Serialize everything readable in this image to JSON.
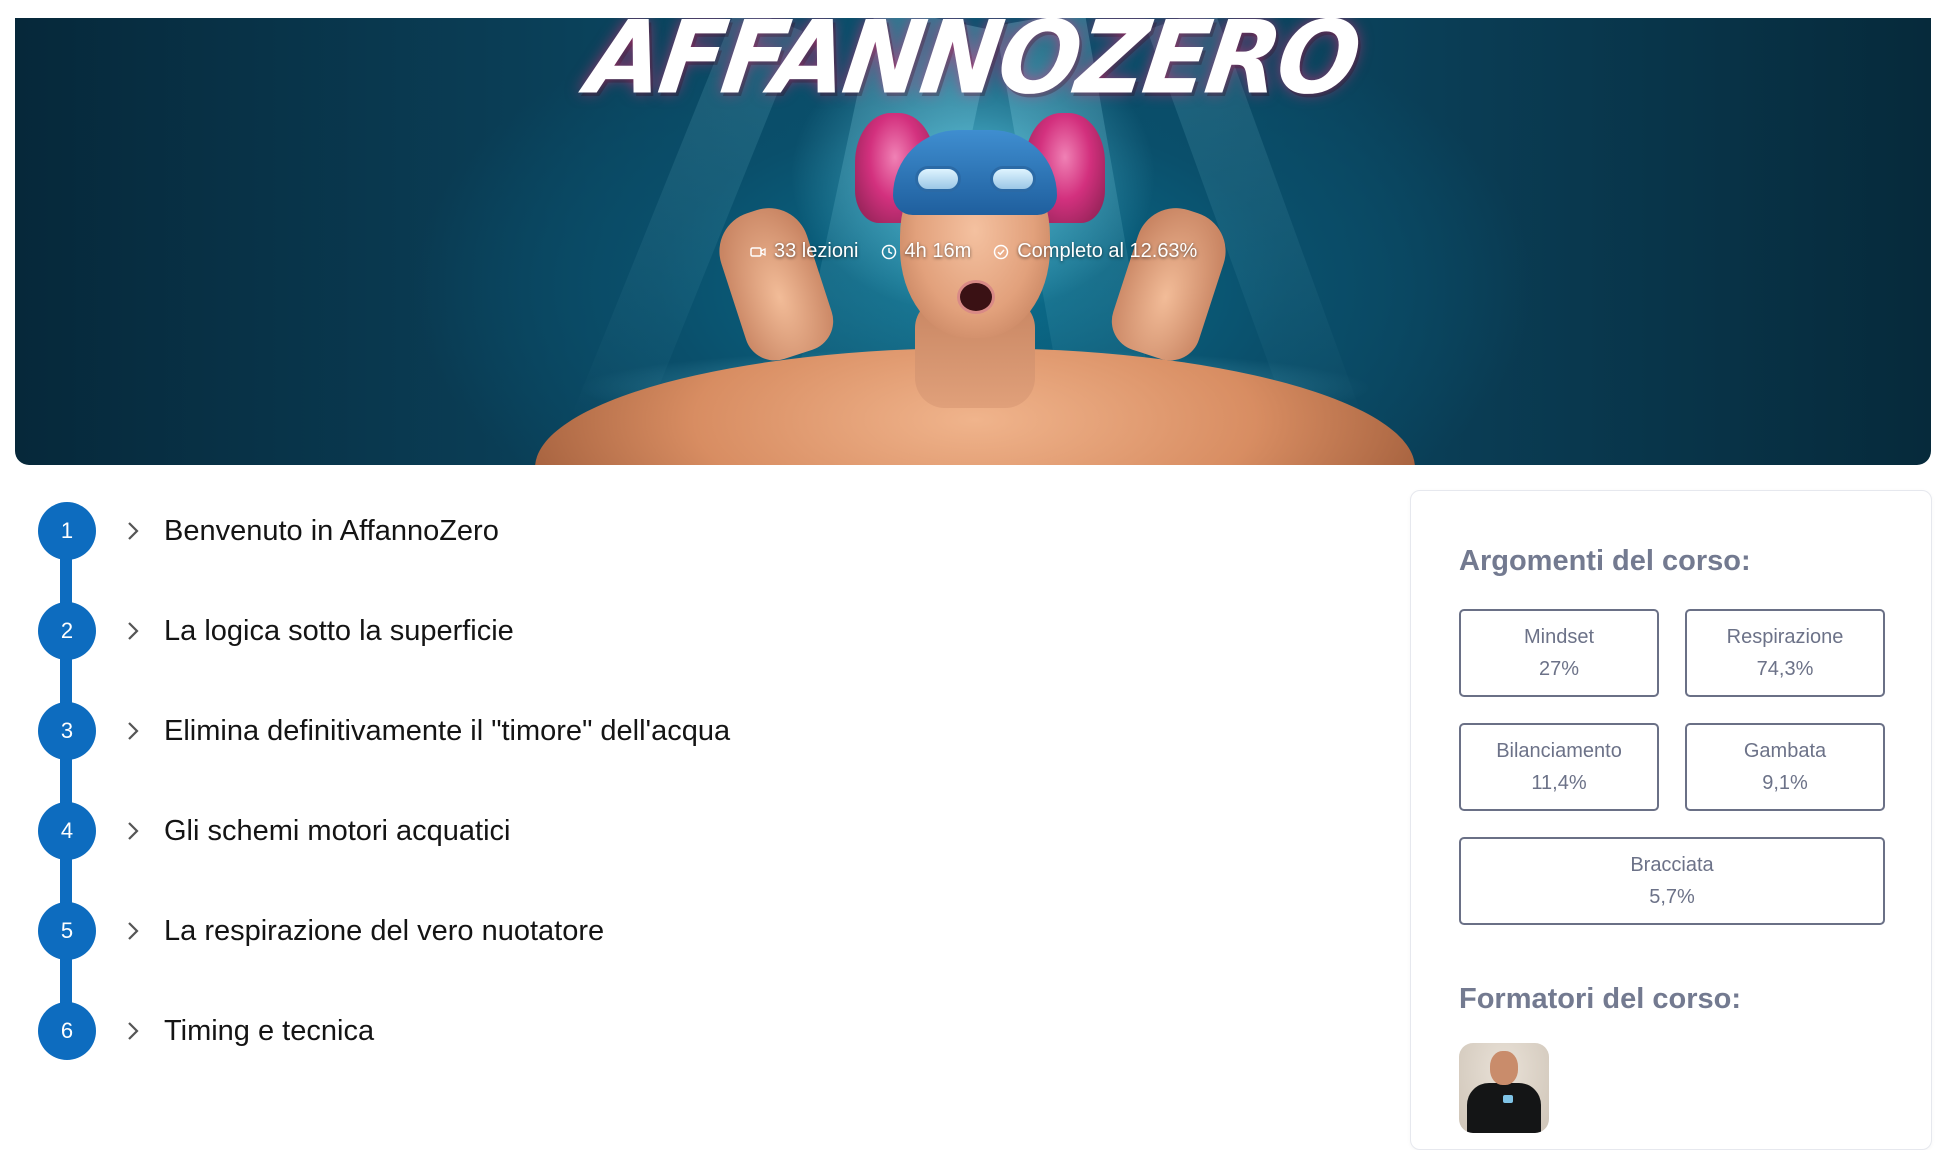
{
  "hero": {
    "title": "AFFANNOZERO",
    "stats": [
      {
        "icon": "video-icon",
        "text": "33 lezioni"
      },
      {
        "icon": "clock-icon",
        "text": "4h 16m"
      },
      {
        "icon": "check-circle-icon",
        "text": "Completo al 12.63%"
      }
    ]
  },
  "chapters": [
    {
      "number": "1",
      "title": "Benvenuto in AffannoZero"
    },
    {
      "number": "2",
      "title": "La logica sotto la superficie"
    },
    {
      "number": "3",
      "title": "Elimina definitivamente il \"timore\" dell'acqua"
    },
    {
      "number": "4",
      "title": "Gli schemi motori acquatici"
    },
    {
      "number": "5",
      "title": "La respirazione del vero nuotatore"
    },
    {
      "number": "6",
      "title": "Timing e tecnica"
    }
  ],
  "panel": {
    "topics_heading": "Argomenti del corso:",
    "topics": [
      {
        "name": "Mindset",
        "percent": "27%"
      },
      {
        "name": "Respirazione",
        "percent": "74,3%"
      },
      {
        "name": "Bilanciamento",
        "percent": "11,4%"
      },
      {
        "name": "Gambata",
        "percent": "9,1%"
      },
      {
        "name": "Bracciata",
        "percent": "5,7%"
      }
    ],
    "trainers_heading": "Formatori del corso:"
  },
  "colors": {
    "accent": "#0d6cbf",
    "panel_text": "#737a90"
  }
}
